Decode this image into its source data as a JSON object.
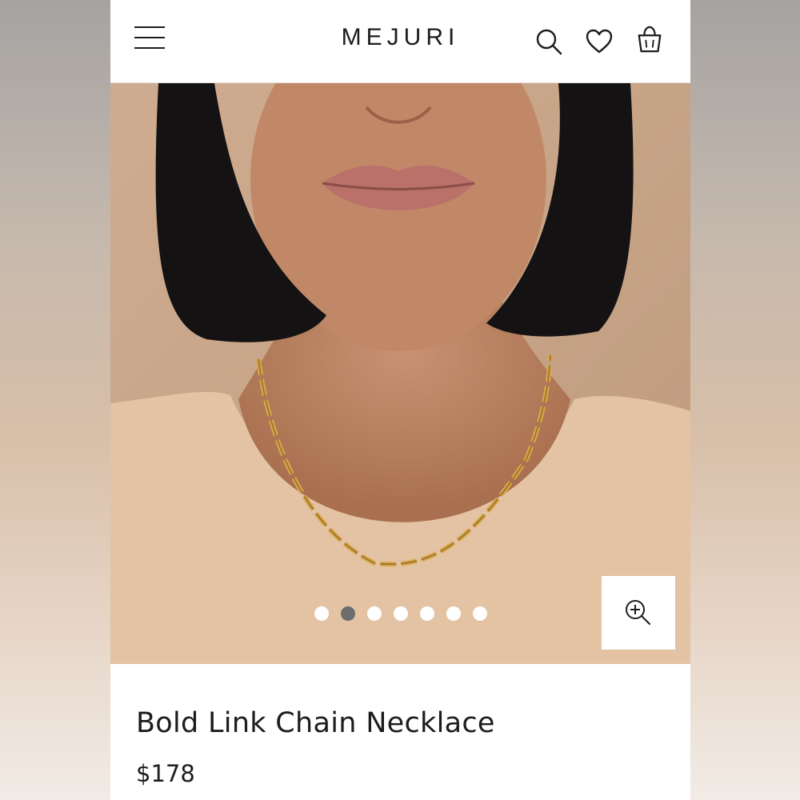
{
  "header": {
    "brand": "MEJURI",
    "icons": [
      "menu-icon",
      "search-icon",
      "heart-icon",
      "bag-icon"
    ]
  },
  "gallery": {
    "slide_count": 7,
    "active_slide": 2,
    "zoom_icon": "zoom-in-icon"
  },
  "product": {
    "title": "Bold Link Chain Necklace",
    "price": "$178"
  },
  "colors": {
    "text": "#1c1c1c",
    "dot_active": "#6d6d6d",
    "dot_inactive": "#ffffff",
    "photo_bg": "#c9a487"
  }
}
